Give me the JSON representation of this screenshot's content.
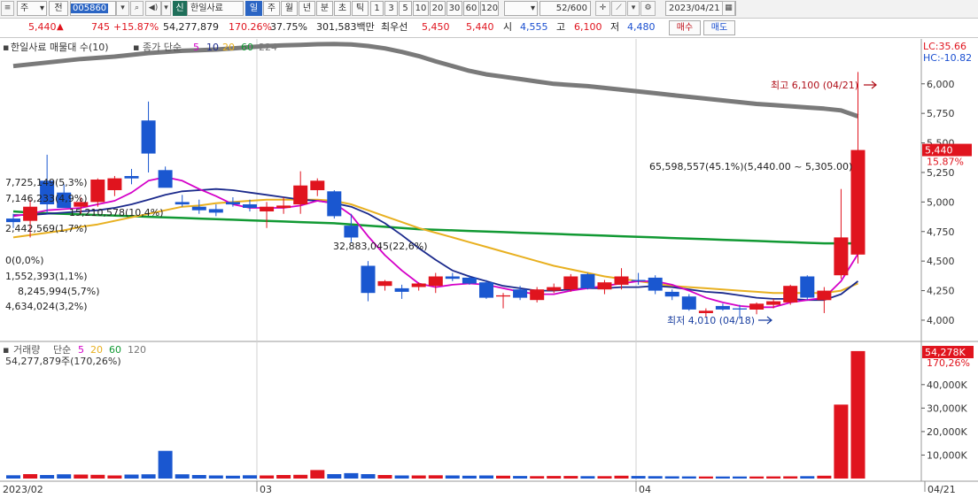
{
  "toolbar": {
    "icon_left": "list-icon",
    "sel_ju": "주",
    "sel_jeon": "전",
    "code": "005860",
    "search_icon": "search-icon",
    "volume_icon": "speaker-icon",
    "badge_sin": "신",
    "stock_name": "한일사료",
    "periods": [
      "일",
      "주",
      "월",
      "년",
      "분",
      "초",
      "틱"
    ],
    "active_period": "일",
    "intervals": [
      "1",
      "3",
      "5",
      "10",
      "20",
      "30",
      "60",
      "120"
    ],
    "count": "52",
    "total": "/600",
    "date": "2023/04/21",
    "calendar_icon": "calendar-icon"
  },
  "quote": {
    "price": "5,440",
    "arrow": "▲",
    "change": "745",
    "change_pct": "+15.87%",
    "volume": "54,277,879",
    "vol_ratio": "170.26%",
    "turnover": "37.75%",
    "amount": "301,583백만",
    "best_ask_label": "최우선",
    "ask": "5,450",
    "bid": "5,440",
    "open_label": "시",
    "open": "4,555",
    "high_label": "고",
    "high": "6,100",
    "low_label": "저",
    "low": "4,480",
    "buy_label": "매수",
    "sell_label": "매도"
  },
  "colors": {
    "up": "#e0141e",
    "down": "#1a57d0",
    "ma5": "#d400c8",
    "ma10": "#1b2a8c",
    "ma20": "#e8b020",
    "ma60": "#119933",
    "ma224": "#7a7a7a"
  },
  "chart_data": {
    "type": "candlestick",
    "price_panel": {
      "legend_title": "한일사료 매물대 수(10)",
      "ma_title": "종가 단순",
      "ma_periods": [
        "5",
        "10",
        "20",
        "60",
        "224"
      ],
      "lc": "LC:35.66",
      "hc": "HC:-10.82",
      "ylim": [
        3850,
        6350
      ],
      "y_ticks": [
        "6,000",
        "5,750",
        "5,500",
        "5,250",
        "5,000",
        "4,750",
        "4,500",
        "4,250",
        "4,000"
      ],
      "last_price": "5,440",
      "last_pct": "15.87%",
      "high_marker": "최고 6,100 (04/21)",
      "low_marker": "최저 4,010 (04/18)",
      "ma224_values": [
        6150,
        6370
      ],
      "volume_profile": [
        {
          "label": "65,598,557(45.1%)(5,440.00 ~ 5,305.00)",
          "low": 5305,
          "high": 5440,
          "frac": 0.9
        },
        {
          "label": "7,725,149(5,3%)",
          "low": 5170,
          "high": 5305,
          "frac": 0.11
        },
        {
          "label": "7,146,233(4,9%)",
          "low": 5035,
          "high": 5170,
          "frac": 0.09
        },
        {
          "label": "15,210,578(10,4%)",
          "low": 4900,
          "high": 5035,
          "frac": 0.21
        },
        {
          "label": "2,442,569(1,7%)",
          "low": 4765,
          "high": 4900,
          "frac": 0.04
        },
        {
          "label": "32,883,045(22,6%)",
          "low": 4630,
          "high": 4765,
          "frac": 0.45
        },
        {
          "label": "0(0,0%)",
          "low": 4495,
          "high": 4630,
          "frac": 0.0
        },
        {
          "label": "1,552,393(1,1%)",
          "low": 4360,
          "high": 4495,
          "frac": 0.02
        },
        {
          "label": "8,245,994(5,7%)",
          "low": 4225,
          "high": 4360,
          "frac": 0.12
        },
        {
          "label": "4,634,024(3,2%)",
          "low": 4090,
          "high": 4225,
          "frac": 0.07
        }
      ]
    },
    "volume_panel": {
      "legend_title": "거래량",
      "ma_title": "단순",
      "ma_periods": [
        "5",
        "20",
        "60",
        "120"
      ],
      "value_label": "54,277,879주(170,26%)",
      "last_value": "54,278K",
      "last_pct": "170,26%",
      "ylim": [
        0,
        55000
      ],
      "y_ticks": [
        "40,000K",
        "30,000K",
        "20,000K",
        "10,000K"
      ]
    },
    "x_labels": [
      "2023/02",
      "03",
      "04",
      "04/21"
    ],
    "candles": [
      {
        "o": 4860,
        "h": 4900,
        "l": 4780,
        "c": 4830
      },
      {
        "o": 4840,
        "h": 5020,
        "l": 4700,
        "c": 4960
      },
      {
        "o": 5180,
        "h": 5400,
        "l": 4900,
        "c": 4980
      },
      {
        "o": 5080,
        "h": 5150,
        "l": 4960,
        "c": 4950
      },
      {
        "o": 4960,
        "h": 5040,
        "l": 4900,
        "c": 5000
      },
      {
        "o": 5000,
        "h": 5200,
        "l": 4960,
        "c": 5190
      },
      {
        "o": 5100,
        "h": 5220,
        "l": 5050,
        "c": 5200
      },
      {
        "o": 5220,
        "h": 5280,
        "l": 5150,
        "c": 5200
      },
      {
        "o": 5690,
        "h": 5850,
        "l": 5250,
        "c": 5410
      },
      {
        "o": 5270,
        "h": 5300,
        "l": 5130,
        "c": 5120
      },
      {
        "o": 5000,
        "h": 5060,
        "l": 4960,
        "c": 4980
      },
      {
        "o": 4960,
        "h": 5020,
        "l": 4900,
        "c": 4930
      },
      {
        "o": 4940,
        "h": 4980,
        "l": 4880,
        "c": 4910
      },
      {
        "o": 5000,
        "h": 5040,
        "l": 4960,
        "c": 4980
      },
      {
        "o": 4980,
        "h": 5020,
        "l": 4920,
        "c": 4950
      },
      {
        "o": 4920,
        "h": 5000,
        "l": 4780,
        "c": 4960
      },
      {
        "o": 4950,
        "h": 5040,
        "l": 4900,
        "c": 4970
      },
      {
        "o": 4980,
        "h": 5260,
        "l": 4900,
        "c": 5140
      },
      {
        "o": 5100,
        "h": 5200,
        "l": 5050,
        "c": 5180
      },
      {
        "o": 5090,
        "h": 5100,
        "l": 4860,
        "c": 4880
      },
      {
        "o": 4800,
        "h": 4900,
        "l": 4660,
        "c": 4700
      },
      {
        "o": 4460,
        "h": 4500,
        "l": 4160,
        "c": 4230
      },
      {
        "o": 4290,
        "h": 4340,
        "l": 4250,
        "c": 4330
      },
      {
        "o": 4270,
        "h": 4300,
        "l": 4180,
        "c": 4240
      },
      {
        "o": 4280,
        "h": 4320,
        "l": 4250,
        "c": 4310
      },
      {
        "o": 4290,
        "h": 4400,
        "l": 4230,
        "c": 4370
      },
      {
        "o": 4370,
        "h": 4400,
        "l": 4330,
        "c": 4350
      },
      {
        "o": 4360,
        "h": 4380,
        "l": 4300,
        "c": 4310
      },
      {
        "o": 4320,
        "h": 4340,
        "l": 4180,
        "c": 4190
      },
      {
        "o": 4200,
        "h": 4230,
        "l": 4100,
        "c": 4210
      },
      {
        "o": 4260,
        "h": 4290,
        "l": 4170,
        "c": 4190
      },
      {
        "o": 4170,
        "h": 4280,
        "l": 4150,
        "c": 4260
      },
      {
        "o": 4250,
        "h": 4310,
        "l": 4230,
        "c": 4280
      },
      {
        "o": 4260,
        "h": 4390,
        "l": 4240,
        "c": 4370
      },
      {
        "o": 4390,
        "h": 4400,
        "l": 4260,
        "c": 4270
      },
      {
        "o": 4260,
        "h": 4340,
        "l": 4220,
        "c": 4320
      },
      {
        "o": 4300,
        "h": 4440,
        "l": 4260,
        "c": 4370
      },
      {
        "o": 4340,
        "h": 4400,
        "l": 4300,
        "c": 4330
      },
      {
        "o": 4360,
        "h": 4380,
        "l": 4220,
        "c": 4250
      },
      {
        "o": 4240,
        "h": 4260,
        "l": 4170,
        "c": 4200
      },
      {
        "o": 4200,
        "h": 4220,
        "l": 4080,
        "c": 4090
      },
      {
        "o": 4060,
        "h": 4100,
        "l": 4030,
        "c": 4080
      },
      {
        "o": 4120,
        "h": 4140,
        "l": 4080,
        "c": 4090
      },
      {
        "o": 4100,
        "h": 4130,
        "l": 4010,
        "c": 4090
      },
      {
        "o": 4090,
        "h": 4150,
        "l": 4050,
        "c": 4140
      },
      {
        "o": 4130,
        "h": 4180,
        "l": 4100,
        "c": 4160
      },
      {
        "o": 4150,
        "h": 4300,
        "l": 4130,
        "c": 4290
      },
      {
        "o": 4370,
        "h": 4380,
        "l": 4170,
        "c": 4190
      },
      {
        "o": 4170,
        "h": 4280,
        "l": 4060,
        "c": 4250
      },
      {
        "o": 4380,
        "h": 5110,
        "l": 4350,
        "c": 4700
      },
      {
        "o": 4555,
        "h": 6100,
        "l": 4480,
        "c": 5440
      }
    ],
    "volumes": [
      1400,
      1900,
      1500,
      1800,
      1700,
      1600,
      1300,
      1700,
      1800,
      11800,
      1800,
      1500,
      1300,
      1200,
      1400,
      1300,
      1500,
      1600,
      3600,
      1900,
      2300,
      1900,
      1500,
      1300,
      1300,
      1400,
      1300,
      1200,
      1300,
      1200,
      1100,
      1000,
      1100,
      1100,
      1000,
      1000,
      1200,
      1100,
      1000,
      950,
      900,
      850,
      850,
      850,
      850,
      900,
      950,
      1000,
      1200,
      31500,
      54278
    ],
    "ma5": [
      4880,
      4900,
      4930,
      4940,
      4950,
      4980,
      5010,
      5080,
      5180,
      5210,
      5180,
      5110,
      5050,
      4980,
      4950,
      4950,
      4950,
      4970,
      5010,
      4990,
      4890,
      4710,
      4550,
      4420,
      4310,
      4280,
      4300,
      4310,
      4300,
      4270,
      4240,
      4220,
      4220,
      4250,
      4270,
      4290,
      4310,
      4330,
      4330,
      4300,
      4250,
      4190,
      4150,
      4120,
      4110,
      4110,
      4150,
      4170,
      4190,
      4330,
      4560
    ],
    "ma10": [
      4890,
      4890,
      4900,
      4910,
      4920,
      4930,
      4950,
      4980,
      5020,
      5060,
      5090,
      5100,
      5110,
      5100,
      5080,
      5060,
      5040,
      5020,
      5010,
      4990,
      4960,
      4900,
      4820,
      4720,
      4610,
      4510,
      4420,
      4370,
      4330,
      4290,
      4270,
      4250,
      4250,
      4260,
      4270,
      4270,
      4280,
      4280,
      4290,
      4280,
      4260,
      4240,
      4230,
      4210,
      4190,
      4180,
      4180,
      4170,
      4170,
      4220,
      4330
    ],
    "ma20": [
      4700,
      4720,
      4740,
      4760,
      4790,
      4810,
      4840,
      4870,
      4900,
      4930,
      4960,
      4970,
      4990,
      5000,
      5010,
      5020,
      5020,
      5020,
      5020,
      5010,
      4980,
      4930,
      4880,
      4830,
      4780,
      4740,
      4700,
      4660,
      4620,
      4580,
      4540,
      4500,
      4460,
      4430,
      4400,
      4370,
      4350,
      4330,
      4310,
      4290,
      4280,
      4270,
      4260,
      4250,
      4240,
      4230,
      4230,
      4230,
      4230,
      4250,
      4310
    ],
    "ma60": [
      4920,
      4910,
      4905,
      4900,
      4895,
      4890,
      4885,
      4880,
      4875,
      4870,
      4865,
      4860,
      4855,
      4850,
      4845,
      4840,
      4835,
      4830,
      4825,
      4820,
      4810,
      4800,
      4790,
      4780,
      4770,
      4765,
      4760,
      4755,
      4750,
      4745,
      4740,
      4735,
      4730,
      4725,
      4720,
      4715,
      4710,
      4705,
      4700,
      4695,
      4690,
      4685,
      4680,
      4675,
      4670,
      4665,
      4660,
      4655,
      4650,
      4650,
      4650
    ],
    "ma224": [
      6150,
      6165,
      6180,
      6195,
      6210,
      6220,
      6230,
      6245,
      6260,
      6270,
      6280,
      6285,
      6290,
      6300,
      6310,
      6320,
      6325,
      6330,
      6335,
      6337,
      6333,
      6320,
      6300,
      6270,
      6235,
      6190,
      6150,
      6110,
      6080,
      6060,
      6040,
      6020,
      6000,
      5990,
      5980,
      5965,
      5950,
      5935,
      5920,
      5905,
      5890,
      5875,
      5860,
      5845,
      5830,
      5820,
      5810,
      5800,
      5790,
      5775,
      5725
    ]
  }
}
